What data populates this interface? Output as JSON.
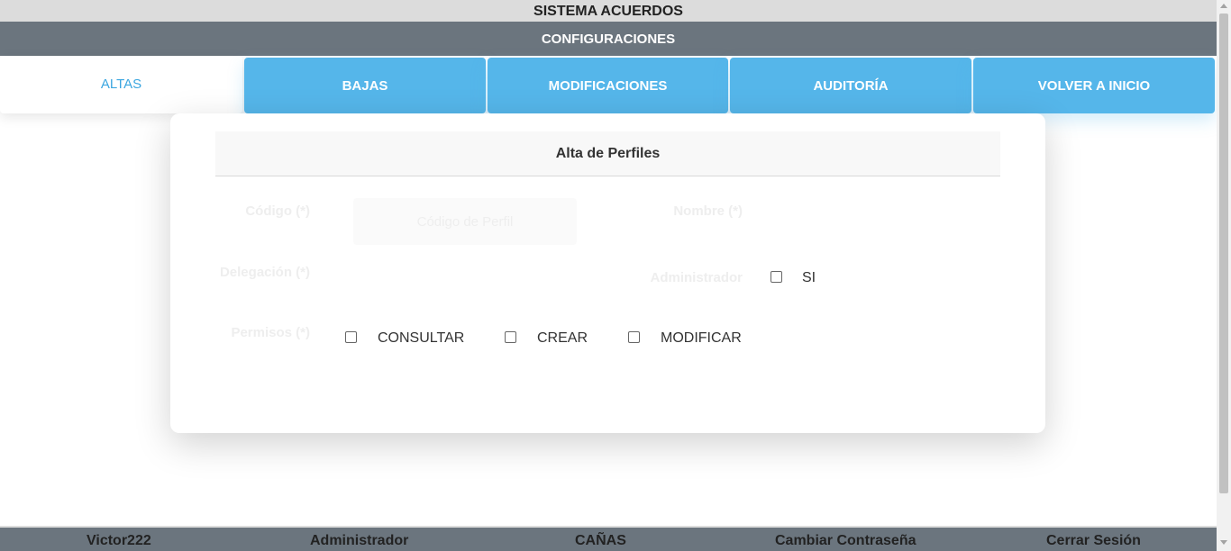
{
  "header": {
    "app_title": "SISTEMA ACUERDOS",
    "section_title": "CONFIGURACIONES"
  },
  "tabs": [
    {
      "label": "ALTAS",
      "active": true
    },
    {
      "label": "BAJAS",
      "active": false
    },
    {
      "label": "MODIFICACIONES",
      "active": false
    },
    {
      "label": "AUDITORÍA",
      "active": false
    },
    {
      "label": "VOLVER A INICIO",
      "active": false
    }
  ],
  "form": {
    "title": "Alta de Perfiles",
    "codigo_label": "Código (*)",
    "codigo_placeholder": "Código de Perfil",
    "nombre_label": "Nombre (*)",
    "delegacion_label": "Delegación (*)",
    "administrador_label": "Administrador",
    "administrador_option": "SI",
    "permisos_label": "Permisos (*)",
    "permisos": [
      {
        "label": "CONSULTAR",
        "checked": false
      },
      {
        "label": "CREAR",
        "checked": false
      },
      {
        "label": "MODIFICAR",
        "checked": false
      }
    ]
  },
  "footer": {
    "user": "Victor222",
    "role": "Administrador",
    "location": "CAÑAS",
    "change_password": "Cambiar Contraseña",
    "logout": "Cerrar Sesión"
  },
  "colors": {
    "tab_blue": "#55b6ea",
    "bar_gray": "#6b757e",
    "active_tab_text": "#3aa6e0"
  }
}
